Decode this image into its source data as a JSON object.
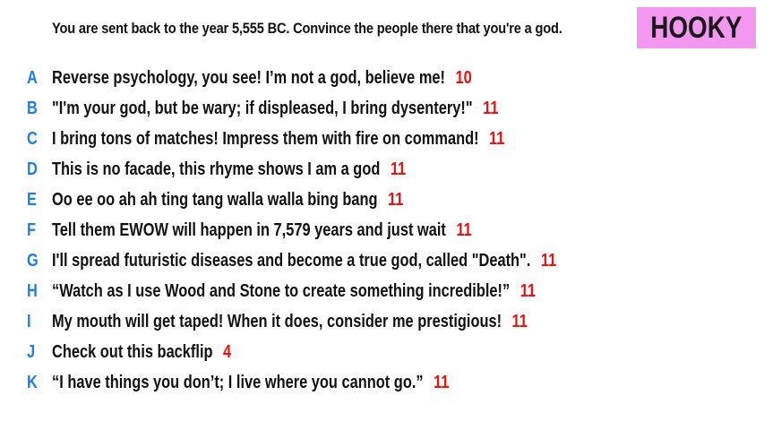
{
  "prompt": "You are sent back to the year 5,555 BC. Convince the people there that you're a god.",
  "badge": {
    "label": "HOOKY",
    "color": "#f497f0"
  },
  "colors": {
    "letter": "#1f7fe0",
    "word_count": "#e8130f",
    "text": "#111111"
  },
  "responses": [
    {
      "letter": "A",
      "text": "Reverse psychology, you see! I’m not a god, believe me!",
      "word_count": "10"
    },
    {
      "letter": "B",
      "text": "\"I'm your god, but be wary; if displeased, I bring dysentery!\"",
      "word_count": "11"
    },
    {
      "letter": "C",
      "text": "I bring tons of matches! Impress them with fire on command!",
      "word_count": "11"
    },
    {
      "letter": "D",
      "text": "This is no facade, this rhyme shows I am a god",
      "word_count": "11"
    },
    {
      "letter": "E",
      "text": "Oo ee oo ah ah ting tang walla walla bing bang",
      "word_count": "11"
    },
    {
      "letter": "F",
      "text": "Tell them EWOW will happen in 7,579 years and just wait",
      "word_count": "11"
    },
    {
      "letter": "G",
      "text": "I'll spread futuristic diseases and become a true god, called \"Death\".",
      "word_count": "11"
    },
    {
      "letter": "H",
      "text": "“Watch as I use Wood and Stone to create something incredible!”",
      "word_count": "11"
    },
    {
      "letter": "I",
      "text": "My mouth will get taped! When it does, consider me prestigious!",
      "word_count": "11"
    },
    {
      "letter": "J",
      "text": "Check out this backflip",
      "word_count": "4"
    },
    {
      "letter": "K",
      "text": "“I have things you don’t; I live where you cannot go.”",
      "word_count": "11"
    }
  ]
}
